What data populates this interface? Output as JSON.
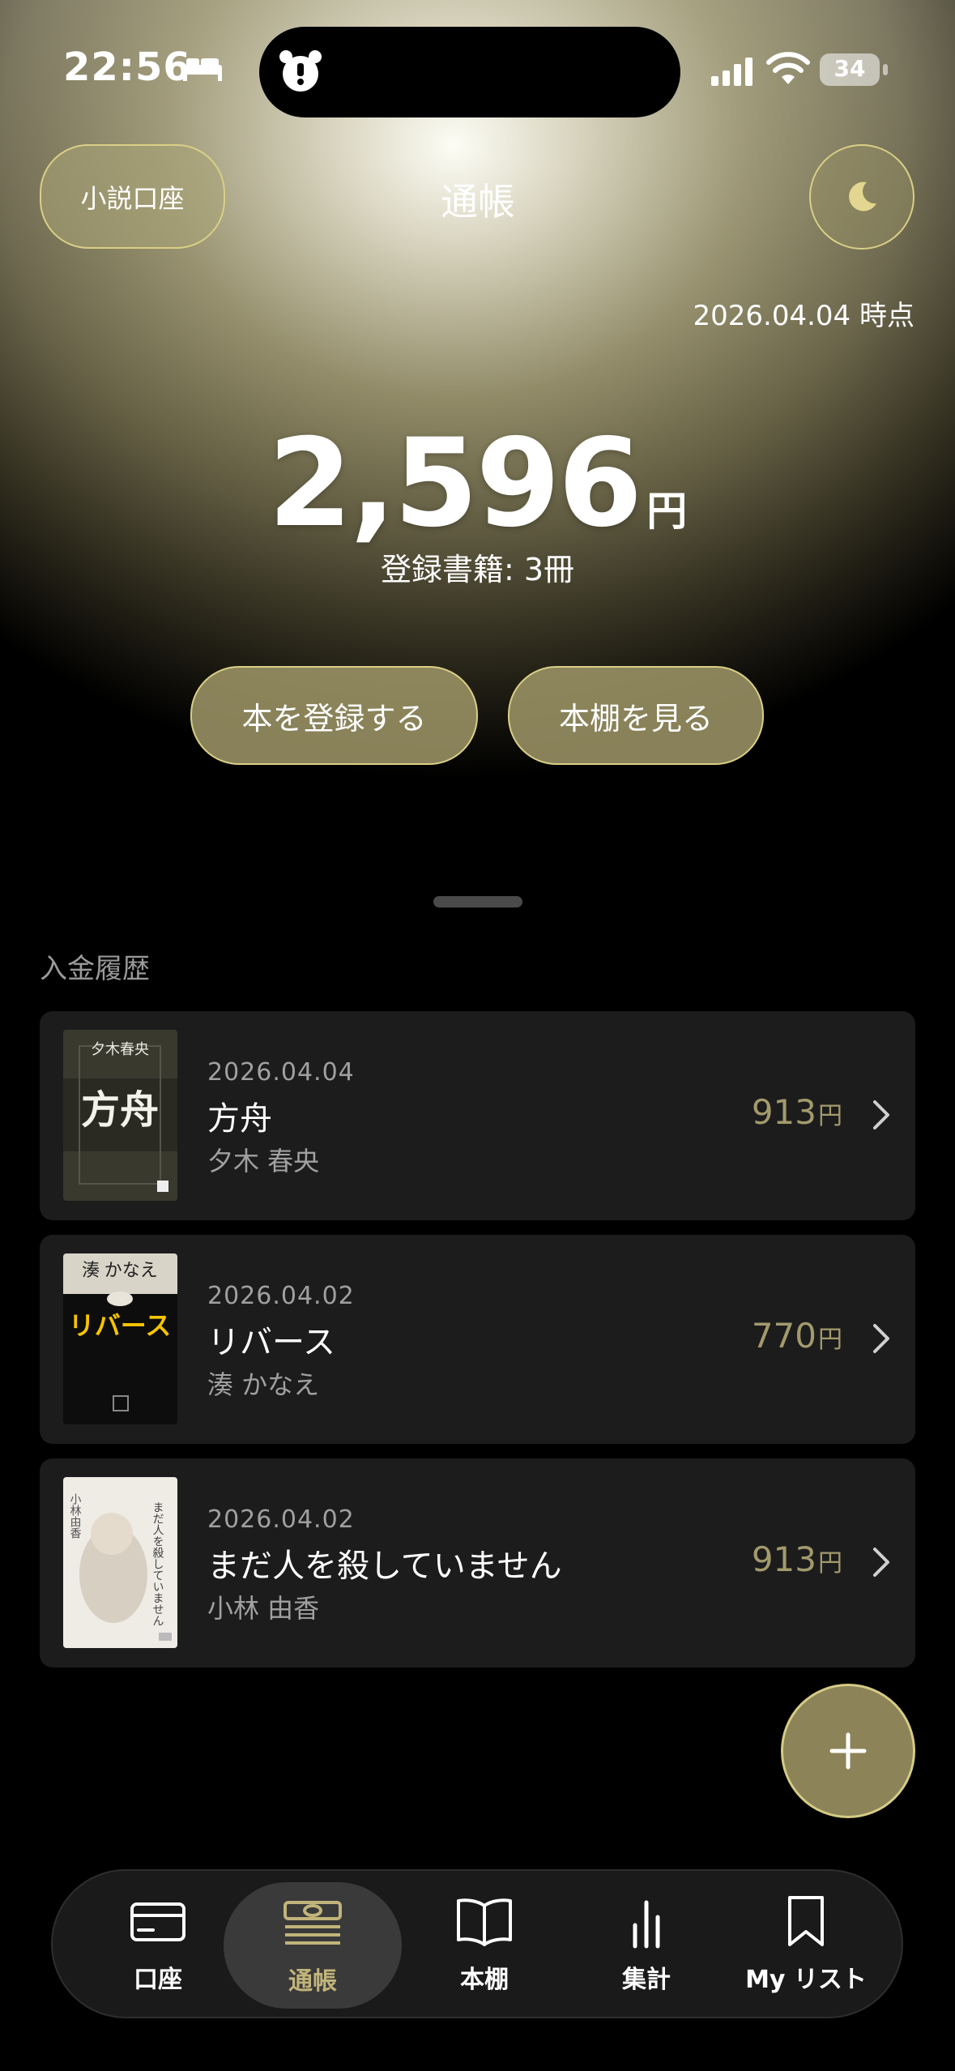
{
  "status_bar": {
    "time": "22:56",
    "battery": "34"
  },
  "header": {
    "account_button": "小説口座",
    "title": "通帳",
    "as_of": "2026.04.04 時点"
  },
  "balance": {
    "amount": "2,596",
    "unit": "円",
    "books_count": "登録書籍: 3冊"
  },
  "actions": {
    "register": "本を登録する",
    "shelf": "本棚を見る"
  },
  "history": {
    "title": "入金履歴",
    "entries": [
      {
        "date": "2026.04.04",
        "title": "方舟",
        "author": "夕木 春央",
        "price": "913",
        "unit": "円",
        "cover_top": "夕木春央",
        "cover_title": "方舟"
      },
      {
        "date": "2026.04.02",
        "title": "リバース",
        "author": "湊 かなえ",
        "price": "770",
        "unit": "円",
        "cover_top": "湊 かなえ",
        "cover_title": "リバース"
      },
      {
        "date": "2026.04.02",
        "title": "まだ人を殺していません",
        "author": "小林 由香",
        "price": "913",
        "unit": "円",
        "cover_top": "小林由香",
        "cover_title": "まだ人を殺していません"
      }
    ]
  },
  "tabbar": {
    "items": [
      {
        "label": "口座",
        "icon": "card-icon"
      },
      {
        "label": "通帳",
        "icon": "passbook-icon",
        "active": true
      },
      {
        "label": "本棚",
        "icon": "book-icon"
      },
      {
        "label": "集計",
        "icon": "bar-chart-icon"
      },
      {
        "label": "My リスト",
        "icon": "bookmark-icon"
      }
    ]
  },
  "colors": {
    "accent_gold": "#d9cf86",
    "price_gold": "#a39a6c",
    "card_bg": "#1c1c1d"
  }
}
